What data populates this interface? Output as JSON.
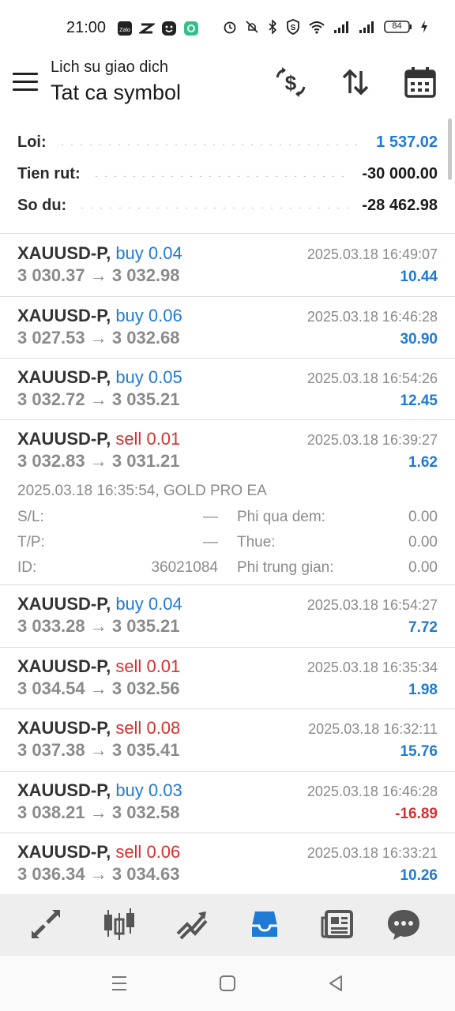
{
  "status_bar": {
    "time": "21:00",
    "battery": "84",
    "left_icons": [
      "zalo-icon",
      "capcut-icon",
      "face-app-icon",
      "chat-app-icon"
    ],
    "right_icons": [
      "alarm-icon",
      "mute-icon",
      "bluetooth-icon",
      "shield-s-icon",
      "wifi-icon",
      "signal-icon",
      "signal-icon",
      "battery-icon",
      "charging-icon"
    ]
  },
  "header": {
    "subtitle": "Lich su giao dich",
    "title": "Tat ca symbol",
    "icons": [
      "deposit-withdraw-icon",
      "sort-icon",
      "calendar-icon"
    ]
  },
  "summary": {
    "profit_label": "Loi:",
    "profit_value": "1 537.02",
    "withdraw_label": "Tien rut:",
    "withdraw_value": "-30 000.00",
    "balance_label": "So du:",
    "balance_value": "-28 462.98"
  },
  "trades": [
    {
      "symbol": "XAUUSD-P,",
      "side": "buy",
      "volume": "0.04",
      "open": "3 030.37",
      "close": "3 032.98",
      "time": "2025.03.18 16:49:07",
      "profit": "10.44"
    },
    {
      "symbol": "XAUUSD-P,",
      "side": "buy",
      "volume": "0.06",
      "open": "3 027.53",
      "close": "3 032.68",
      "time": "2025.03.18 16:46:28",
      "profit": "30.90"
    },
    {
      "symbol": "XAUUSD-P,",
      "side": "buy",
      "volume": "0.05",
      "open": "3 032.72",
      "close": "3 035.21",
      "time": "2025.03.18 16:54:26",
      "profit": "12.45"
    },
    {
      "symbol": "XAUUSD-P,",
      "side": "sell",
      "volume": "0.01",
      "open": "3 032.83",
      "close": "3 031.21",
      "time": "2025.03.18 16:39:27",
      "profit": "1.62"
    },
    {
      "symbol": "XAUUSD-P,",
      "side": "buy",
      "volume": "0.04",
      "open": "3 033.28",
      "close": "3 035.21",
      "time": "2025.03.18 16:54:27",
      "profit": "7.72"
    },
    {
      "symbol": "XAUUSD-P,",
      "side": "sell",
      "volume": "0.01",
      "open": "3 034.54",
      "close": "3 032.56",
      "time": "2025.03.18 16:35:34",
      "profit": "1.98"
    },
    {
      "symbol": "XAUUSD-P,",
      "side": "sell",
      "volume": "0.08",
      "open": "3 037.38",
      "close": "3 035.41",
      "time": "2025.03.18 16:32:11",
      "profit": "15.76"
    },
    {
      "symbol": "XAUUSD-P,",
      "side": "buy",
      "volume": "0.03",
      "open": "3 038.21",
      "close": "3 032.58",
      "time": "2025.03.18 16:46:28",
      "profit": "-16.89"
    },
    {
      "symbol": "XAUUSD-P,",
      "side": "sell",
      "volume": "0.06",
      "open": "3 036.34",
      "close": "3 034.63",
      "time": "2025.03.18 16:33:21",
      "profit": "10.26"
    }
  ],
  "expanded_detail": {
    "open_info": "2025.03.18 16:35:54, GOLD PRO EA",
    "sl_label": "S/L:",
    "sl_value": "—",
    "tp_label": "T/P:",
    "tp_value": "—",
    "id_label": "ID:",
    "id_value": "36021084",
    "swap_label": "Phi qua dem:",
    "swap_value": "0.00",
    "tax_label": "Thue:",
    "tax_value": "0.00",
    "commission_label": "Phi trung gian:",
    "commission_value": "0.00"
  },
  "bottom_nav": {
    "items": [
      "quotes-icon",
      "chart-icon",
      "trade-icon",
      "history-icon",
      "news-icon",
      "chat-icon"
    ],
    "active": "history-icon"
  },
  "system_nav": {
    "items": [
      "recent-apps-icon",
      "home-icon",
      "back-icon"
    ]
  },
  "colors": {
    "accent_blue": "#1f7ad6",
    "sell_red": "#d3302f",
    "muted_gray": "#8a8a8a"
  }
}
